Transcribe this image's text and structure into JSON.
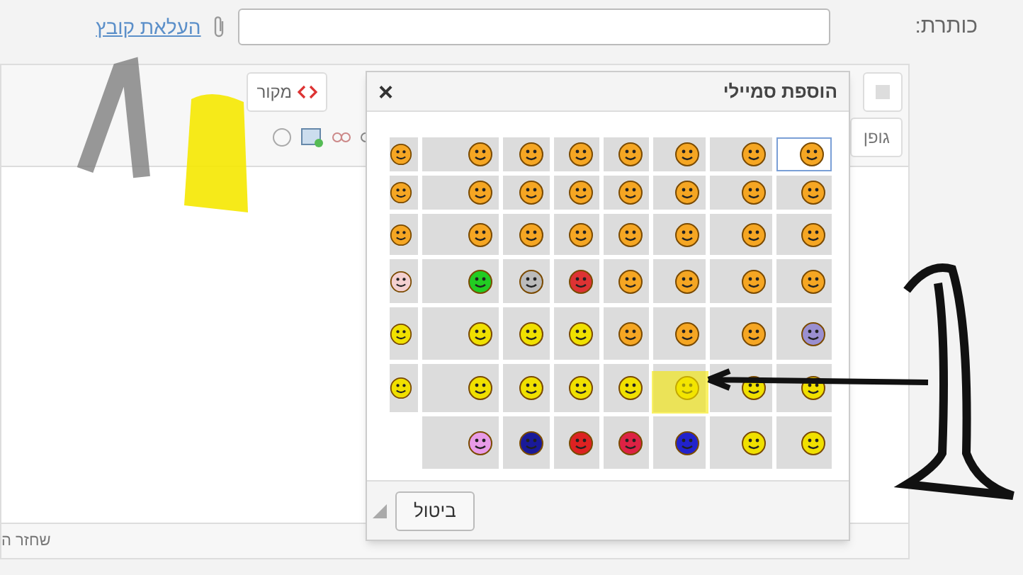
{
  "form": {
    "title_label": "כותרת:",
    "upload_link": "העלאת קובץ"
  },
  "editor": {
    "source_button": "מקור",
    "font_dropdown": "גופן",
    "status_text": "שחזר ה"
  },
  "dialog": {
    "title": "הוספת סמיילי",
    "close": "×",
    "cancel_button": "ביטול",
    "rows": [
      [
        {
          "selected": true,
          "color": "#f5a623"
        },
        {
          "selected": false,
          "color": "#f5a623"
        },
        {
          "selected": false,
          "color": "#f5a623"
        },
        {
          "selected": false,
          "color": "#f5a623"
        },
        {
          "selected": false,
          "color": "#f5a623"
        },
        {
          "selected": false,
          "color": "#f5a623"
        },
        {
          "selected": false,
          "color": "#f5a623"
        },
        {
          "selected": false,
          "color": "#f5a623"
        }
      ],
      [
        {
          "selected": false,
          "color": "#f5a623"
        },
        {
          "selected": false,
          "color": "#f5a623"
        },
        {
          "selected": false,
          "color": "#f5a623"
        },
        {
          "selected": false,
          "color": "#f5a623"
        },
        {
          "selected": false,
          "color": "#f5a623"
        },
        {
          "selected": false,
          "color": "#f5a623"
        },
        {
          "selected": false,
          "color": "#f5a623"
        },
        {
          "selected": false,
          "color": "#f5a623"
        }
      ],
      [
        {
          "selected": false,
          "color": "#f5a623"
        },
        {
          "selected": false,
          "color": "#f5a623"
        },
        {
          "selected": false,
          "color": "#f5a623"
        },
        {
          "selected": false,
          "color": "#f5a623"
        },
        {
          "selected": false,
          "color": "#f5a623"
        },
        {
          "selected": false,
          "color": "#f5a623"
        },
        {
          "selected": false,
          "color": "#f5a623"
        },
        {
          "selected": false,
          "color": "#f5a623"
        }
      ],
      [
        {
          "selected": false,
          "color": "#f5a623"
        },
        {
          "selected": false,
          "color": "#f5a623"
        },
        {
          "selected": false,
          "color": "#f5a623"
        },
        {
          "selected": false,
          "color": "#f5a623"
        },
        {
          "selected": false,
          "color": "#dd3333"
        },
        {
          "selected": false,
          "color": "#bbbbbb"
        },
        {
          "selected": false,
          "color": "#22cc22"
        },
        {
          "selected": false,
          "color": "#f4d0d0"
        }
      ],
      [
        {
          "selected": false,
          "color": "#9a8fd0"
        },
        {
          "selected": false,
          "color": "#f5a623"
        },
        {
          "selected": false,
          "color": "#f5a623"
        },
        {
          "selected": false,
          "color": "#f5a623"
        },
        {
          "selected": false,
          "color": "#f0e000"
        },
        {
          "selected": false,
          "color": "#f0e000"
        },
        {
          "selected": false,
          "color": "#f0e000"
        },
        {
          "selected": false,
          "color": "#f0e000"
        }
      ],
      [
        {
          "selected": false,
          "color": "#f0e000"
        },
        {
          "selected": false,
          "color": "#f0e000"
        },
        {
          "selected": false,
          "color": "#f0e000"
        },
        {
          "selected": false,
          "color": "#f0e000"
        },
        {
          "selected": false,
          "color": "#f0e000"
        },
        {
          "selected": false,
          "color": "#f0e000"
        },
        {
          "selected": false,
          "color": "#f0e000"
        },
        {
          "selected": false,
          "color": "#f0e000"
        }
      ],
      [
        {
          "selected": false,
          "color": "#f0e000"
        },
        {
          "selected": false,
          "color": "#f0e000"
        },
        {
          "selected": false,
          "color": "#2222cc"
        },
        {
          "selected": false,
          "color": "#dd2244"
        },
        {
          "selected": false,
          "color": "#dd2222"
        },
        {
          "selected": false,
          "color": "#1a1a99"
        },
        {
          "selected": false,
          "color": "#e89be8"
        }
      ]
    ]
  }
}
